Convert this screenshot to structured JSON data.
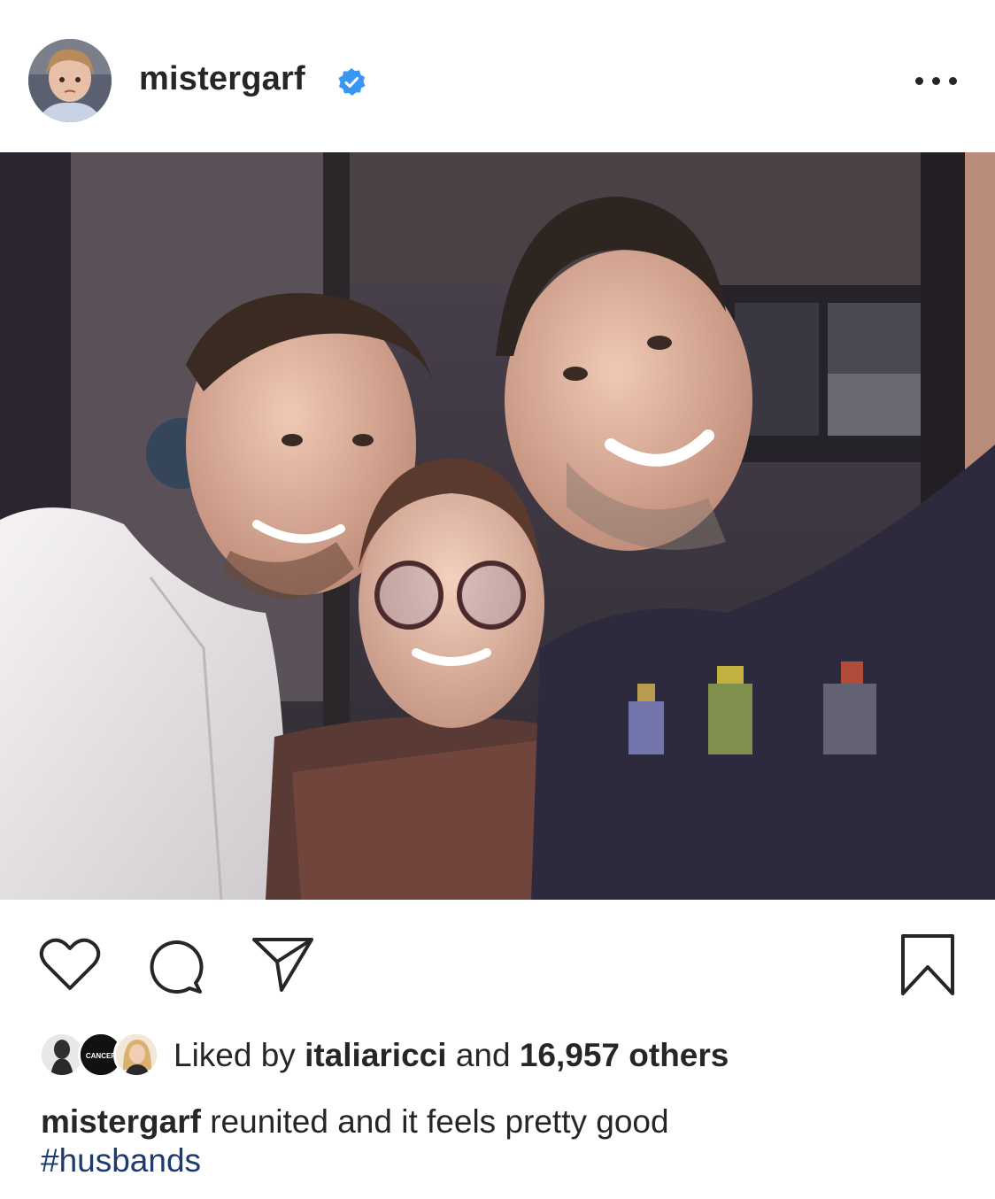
{
  "post": {
    "username": "mistergarf",
    "verified": true,
    "more_icon": "more-options-icon",
    "photo_alt": "Selfie of three people"
  },
  "actions": {
    "like_icon": "heart-icon",
    "comment_icon": "comment-icon",
    "share_icon": "send-icon",
    "save_icon": "bookmark-icon"
  },
  "likes": {
    "prefix": "Liked by",
    "first_liker": "italiaricci",
    "connector": "and",
    "count_text": "16,957 others",
    "avatar_badge": "CANCER"
  },
  "caption": {
    "username": "mistergarf",
    "text": "reunited and it feels pretty good",
    "hashtag": "#husbands"
  },
  "colors": {
    "text": "#262626",
    "verified_blue": "#3897f0",
    "hashtag": "#1d3b6e"
  }
}
